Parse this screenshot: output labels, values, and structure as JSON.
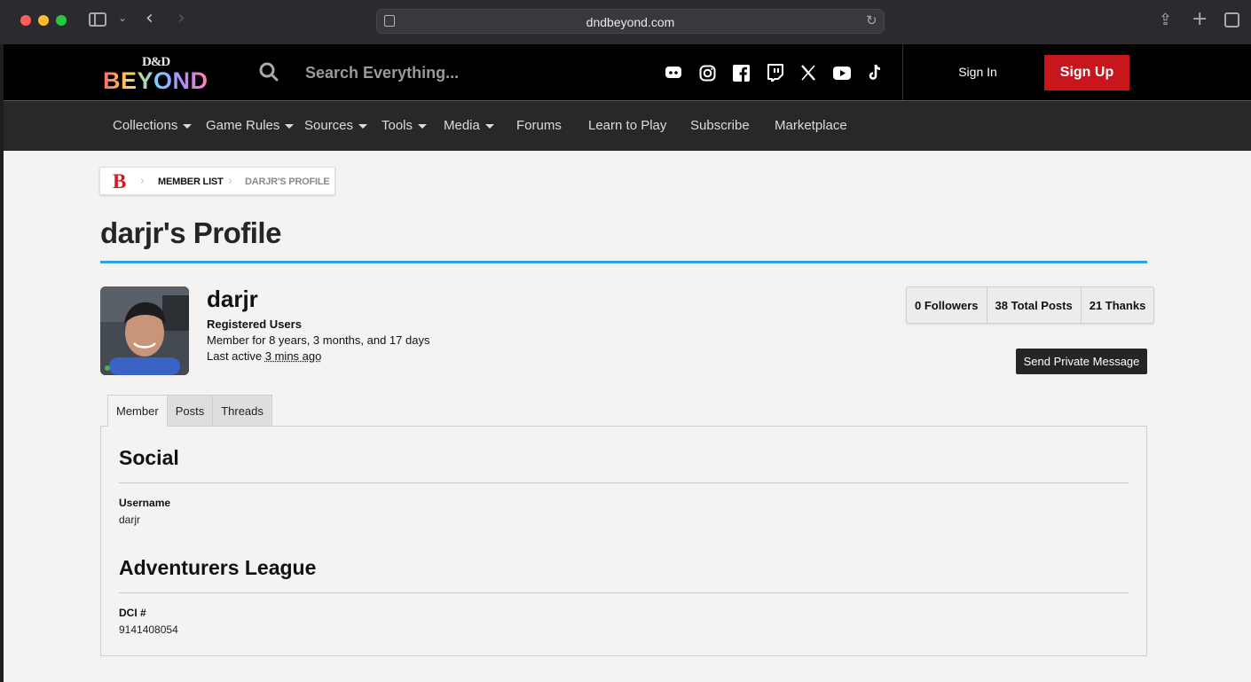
{
  "browser": {
    "url": "dndbeyond.com"
  },
  "header": {
    "logo_top": "D&D",
    "logo_bottom": "BEYOND",
    "search_placeholder": "Search Everything...",
    "social_icons": [
      "discord-icon",
      "instagram-icon",
      "facebook-icon",
      "twitch-icon",
      "x-icon",
      "youtube-icon",
      "tiktok-icon"
    ],
    "sign_in": "Sign In",
    "sign_up": "Sign Up",
    "accent_color": "#c8161d"
  },
  "nav": {
    "items": [
      {
        "label": "Collections",
        "dropdown": true
      },
      {
        "label": "Game Rules",
        "dropdown": true
      },
      {
        "label": "Sources",
        "dropdown": true
      },
      {
        "label": "Tools",
        "dropdown": true
      },
      {
        "label": "Media",
        "dropdown": true
      },
      {
        "label": "Forums",
        "dropdown": false
      },
      {
        "label": "Learn to Play",
        "dropdown": false
      },
      {
        "label": "Subscribe",
        "dropdown": false
      },
      {
        "label": "Marketplace",
        "dropdown": false
      }
    ]
  },
  "breadcrumb": {
    "home_logo": "B",
    "items": [
      "MEMBER LIST",
      "DARJR'S PROFILE"
    ]
  },
  "page": {
    "title": "darjr's Profile"
  },
  "profile": {
    "username": "darjr",
    "role": "Registered Users",
    "member_for": "Member for 8 years, 3 months, and 17 days",
    "last_active_prefix": "Last active ",
    "last_active_ago": "3 mins ago",
    "online": true
  },
  "stats": {
    "followers": "0 Followers",
    "total_posts": "38 Total Posts",
    "thanks": "21 Thanks"
  },
  "actions": {
    "send_pm": "Send Private Message"
  },
  "tabs": [
    {
      "label": "Member",
      "active": true
    },
    {
      "label": "Posts",
      "active": false
    },
    {
      "label": "Threads",
      "active": false
    }
  ],
  "sections": {
    "social": {
      "title": "Social",
      "username_label": "Username",
      "username_value": "darjr"
    },
    "adventurers_league": {
      "title": "Adventurers League",
      "dci_label": "DCI #",
      "dci_value": "9141408054"
    }
  }
}
